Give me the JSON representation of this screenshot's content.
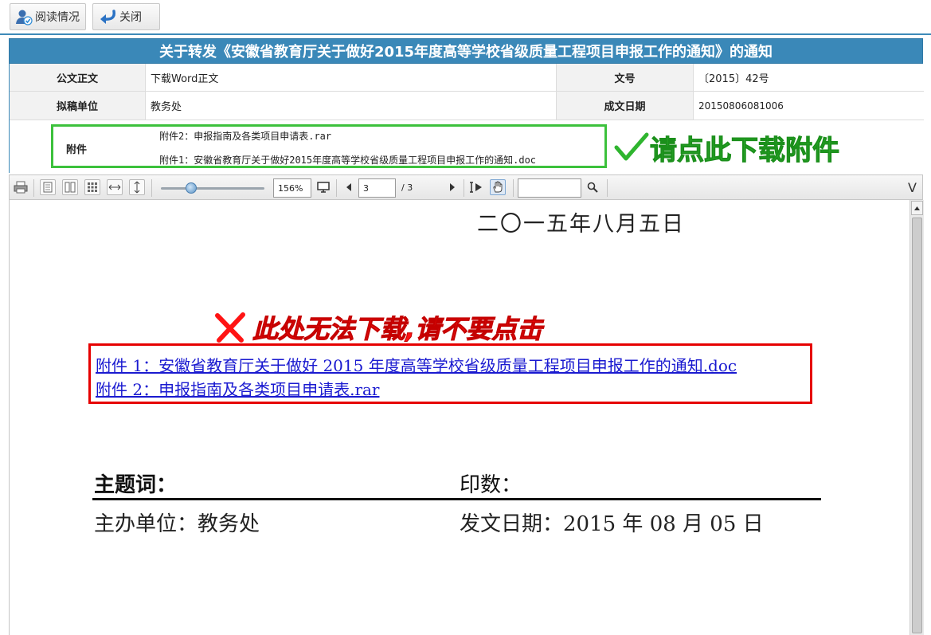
{
  "topbar": {
    "read_status_label": "阅读情况",
    "close_label": "关闭"
  },
  "header": {
    "title": "关于转发《安徽省教育厅关于做好2015年度高等学校省级质量工程项目申报工作的通知》的通知"
  },
  "info": {
    "body_label": "公文正文",
    "body_value": "下载Word正文",
    "docno_label": "文号",
    "docno_value": "〔2015〕42号",
    "drafter_label": "拟稿单位",
    "drafter_value": "教务处",
    "date_label": "成文日期",
    "date_value": "20150806081006",
    "attach_label": "附件",
    "attach_1": "附件2：申报指南及各类项目申请表.rar",
    "attach_2": "附件1：安徽省教育厅关于做好2015年度高等学校省级质量工程项目申报工作的通知.doc"
  },
  "hints": {
    "green": "请点此下载附件",
    "red": "此处无法下载,请不要点击"
  },
  "pdf_toolbar": {
    "zoom": "156%",
    "page_current": "3",
    "page_total": "/ 3",
    "search_value": "",
    "collapse_glyph": "V"
  },
  "pdf": {
    "date_cn": "二〇一五年八月五日",
    "link_1": "附件 1：安徽省教育厅关于做好 2015 年度高等学校省级质量工程项目申报工作的通知.doc",
    "link_2": "附件 2：申报指南及各类项目申请表.rar",
    "keywords": "主题词：",
    "print_count": "印数：",
    "unit": "主办单位：教务处",
    "pub_date": "发文日期：2015 年 08 月 05 日"
  },
  "colors": {
    "header_blue": "#3a88b8",
    "hint_green": "#2fb52f",
    "warn_red": "#ff1414",
    "link_blue": "#1a1ad0"
  }
}
